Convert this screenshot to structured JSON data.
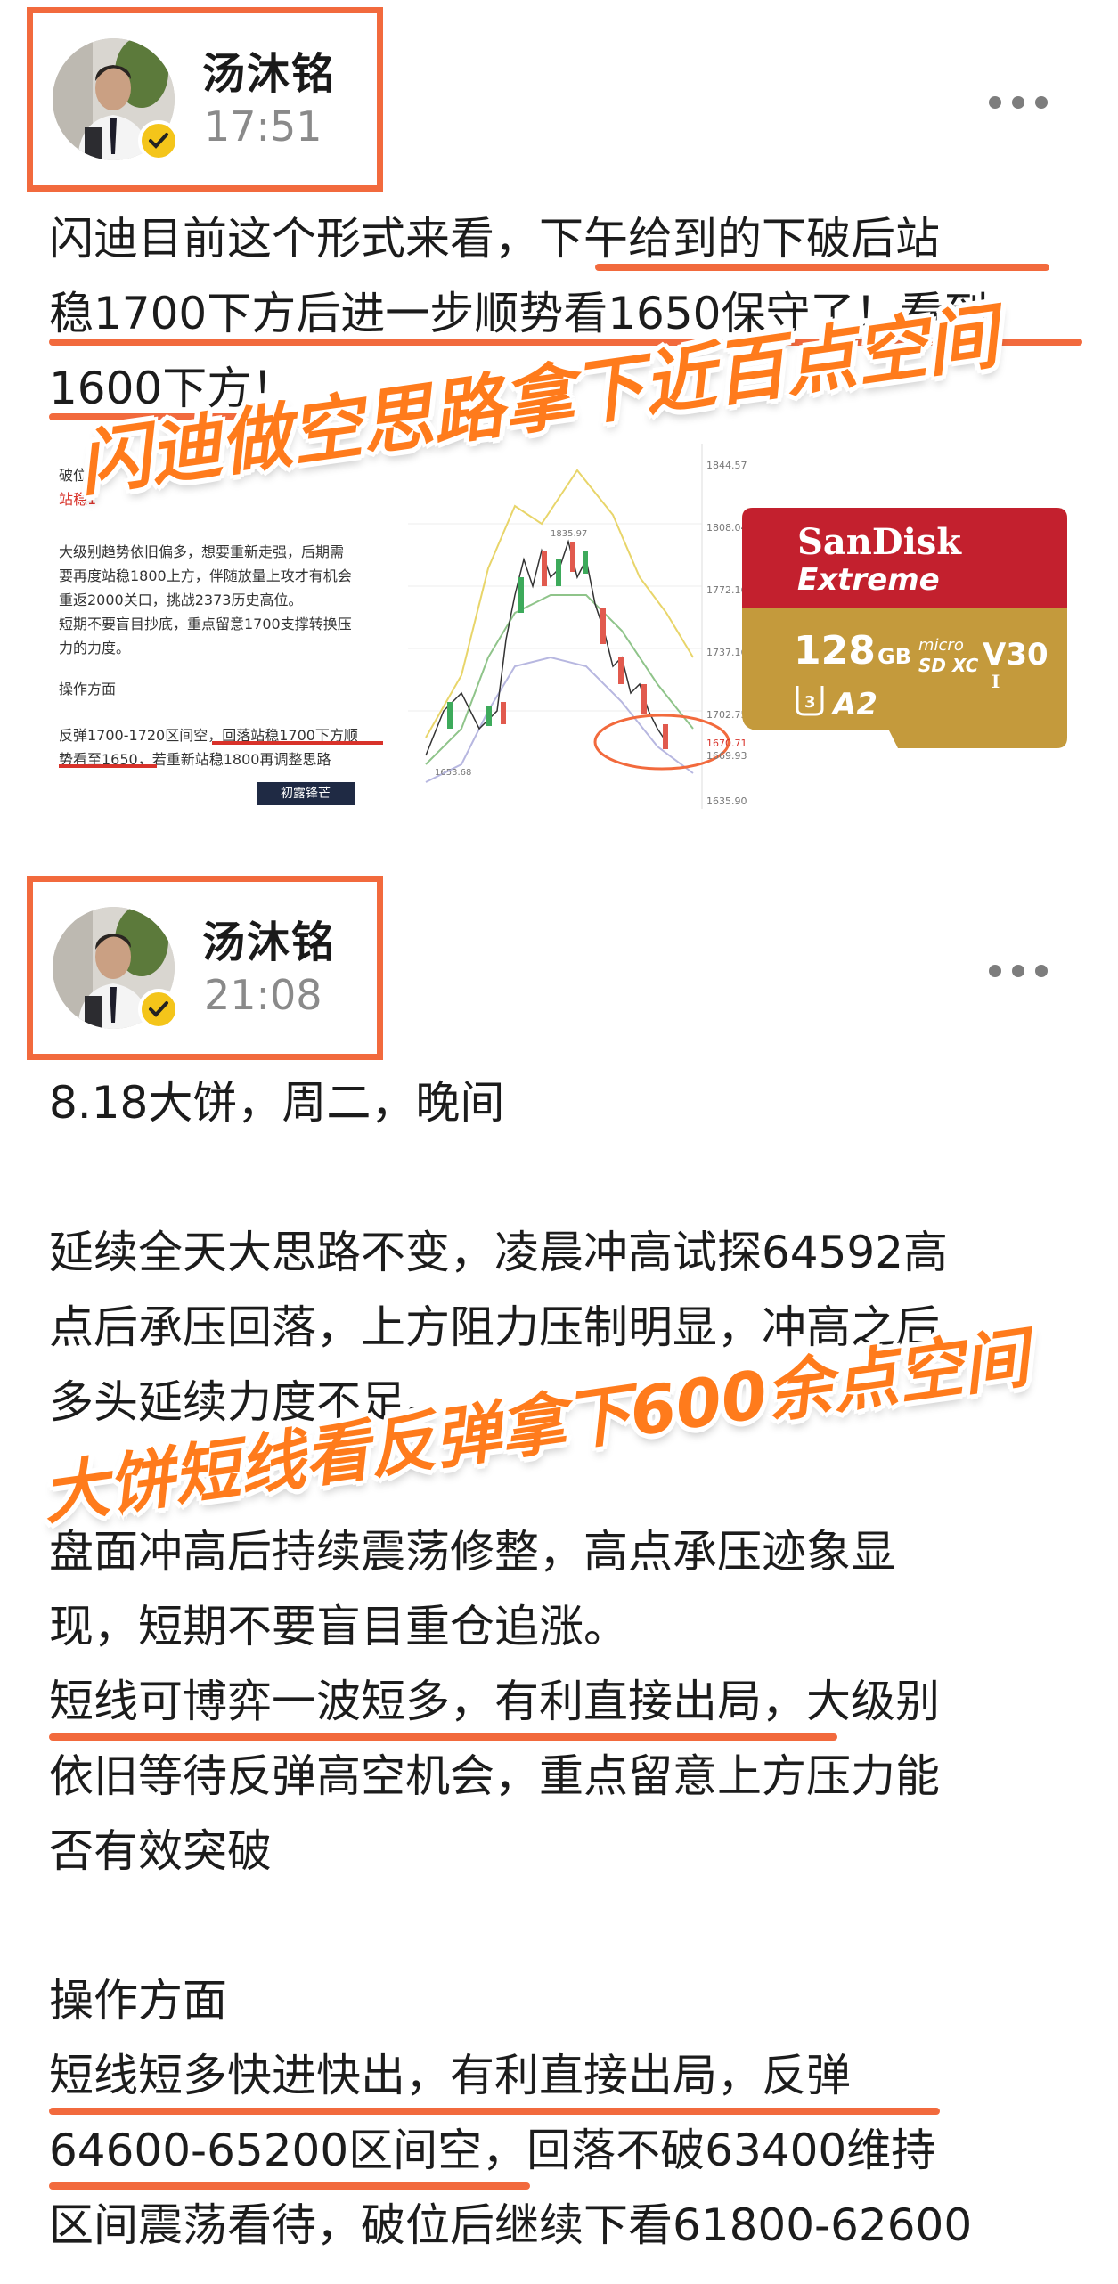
{
  "posts": [
    {
      "username": "汤沐铭",
      "time": "17:51",
      "text_lines": [
        "闪迪目前这个形式来看，下午给到的下破后站",
        "稳1700下方后进一步顺势看1650保守了！看到",
        "1600下方！"
      ],
      "overlay_text": "闪迪做空思路拿下近百点空间",
      "image": {
        "doc_lines": [
          "破位，",
          "站稳1",
          "大级别趋势依旧偏多，想要重新走强，后期需",
          "要再度站稳1800上方，伴随放量上攻才有机会",
          "重返2000关口，挑战2373历史高位。",
          "短期不要盲目抄底，重点留意1700支撑转换压",
          "力的力度。",
          "操作方面",
          "反弹1700-1720区间空，回落站稳1700下方顺",
          "势看至1650，若重新站稳1800再调整思路"
        ],
        "doc_badge": "初露锋芒",
        "chart_price_labels": [
          "1844.57",
          "1808.04",
          "1772.16",
          "1737.16",
          "1702.75",
          "1670.71",
          "1669.93",
          "1635.90"
        ],
        "chart_inner_labels": [
          "1835.97",
          "1653.68"
        ],
        "card": {
          "brand": "SanDisk",
          "line": "Extreme",
          "capacity": "128",
          "capacity_unit": "GB",
          "micro": "micro",
          "sdxc": "SD XC",
          "class": "V30",
          "roman": "I",
          "u3": "3",
          "a2": "A2"
        }
      }
    },
    {
      "username": "汤沐铭",
      "time": "21:08",
      "text_lines": [
        "8.18大饼，周二，晚间",
        "",
        "延续全天大思路不变，凌晨冲高试探64592高",
        "点后承压回落，上方阻力压制明显，冲高之后",
        "多头延续力度不足。",
        "",
        "盘面冲高后持续震荡修整，高点承压迹象显",
        "现，短期不要盲目重仓追涨。",
        "短线可博弈一波短多，有利直接出局，大级别",
        "依旧等待反弹高空机会，重点留意上方压力能",
        "否有效突破",
        "",
        "操作方面",
        "短线短多快进快出，有利直接出局，反弹",
        "64600-65200区间空，回落不破63400维持",
        "区间震荡看待，破位后继续下看61800-62600"
      ],
      "overlay_text": "大饼短线看反弹拿下600余点空间"
    }
  ],
  "colors": {
    "accent_orange": "#f26a3d",
    "overlay_orange": "#ff7b1c",
    "verify_yellow": "#f4c51a",
    "sandisk_red": "#c3202e",
    "sandisk_gold": "#c49a3c"
  }
}
